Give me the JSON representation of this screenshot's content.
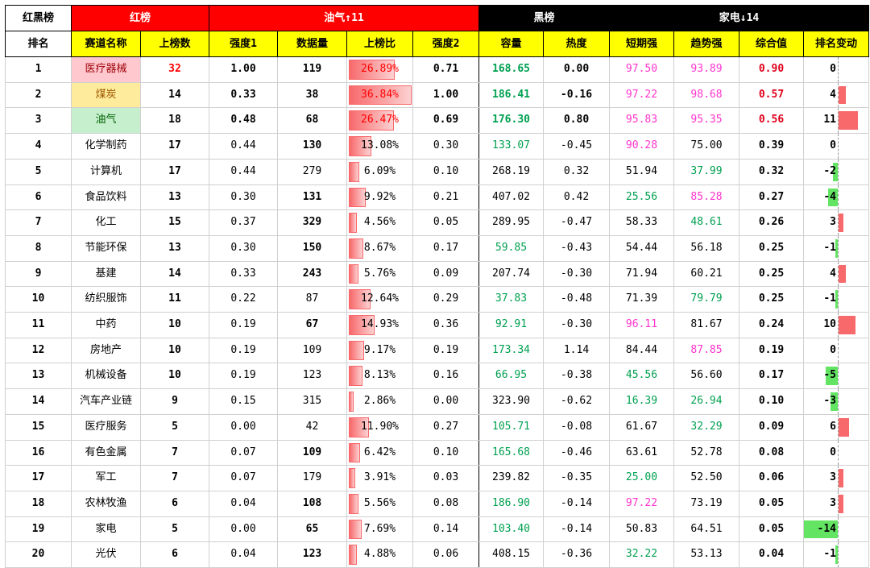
{
  "banner": {
    "title": "红黑榜",
    "red_label": "红榜",
    "top_label": "油气",
    "top_count": "11",
    "black_label": "黑榜",
    "bottom_label": "家电",
    "bottom_count": "14"
  },
  "headers": [
    "排名",
    "赛道名称",
    "上榜数",
    "强度1",
    "数据量",
    "上榜比",
    "强度2",
    "容量",
    "热度",
    "短期强",
    "趋势强",
    "综合值",
    "排名变动"
  ],
  "rows": [
    {
      "rank": "1",
      "name": "医疗器械",
      "count": "32",
      "s1": "1.00",
      "data": "119",
      "ratio": "26.89%",
      "ratio_val": 0.2689,
      "s2": "0.71",
      "cap": "168.65",
      "heat": "0.00",
      "short": "97.50",
      "trend": "93.89",
      "comp": "0.90",
      "chg": "0",
      "chg_val": 0
    },
    {
      "rank": "2",
      "name": "煤炭",
      "count": "14",
      "s1": "0.33",
      "data": "38",
      "ratio": "36.84%",
      "ratio_val": 0.3684,
      "s2": "1.00",
      "cap": "186.41",
      "heat": "-0.16",
      "short": "97.22",
      "trend": "98.68",
      "comp": "0.57",
      "chg": "4",
      "chg_val": 4
    },
    {
      "rank": "3",
      "name": "油气",
      "count": "18",
      "s1": "0.48",
      "data": "68",
      "ratio": "26.47%",
      "ratio_val": 0.2647,
      "s2": "0.69",
      "cap": "176.30",
      "heat": "0.80",
      "short": "95.83",
      "trend": "95.35",
      "comp": "0.56",
      "chg": "11",
      "chg_val": 11
    },
    {
      "rank": "4",
      "name": "化学制药",
      "count": "17",
      "s1": "0.44",
      "data": "130",
      "ratio": "13.08%",
      "ratio_val": 0.1308,
      "s2": "0.30",
      "cap": "133.07",
      "heat": "-0.45",
      "short": "90.28",
      "trend": "75.00",
      "comp": "0.39",
      "chg": "0",
      "chg_val": 0
    },
    {
      "rank": "5",
      "name": "计算机",
      "count": "17",
      "s1": "0.44",
      "data": "279",
      "ratio": "6.09%",
      "ratio_val": 0.0609,
      "s2": "0.10",
      "cap": "268.19",
      "heat": "0.32",
      "short": "51.94",
      "trend": "37.99",
      "comp": "0.32",
      "chg": "-2",
      "chg_val": -2
    },
    {
      "rank": "6",
      "name": "食品饮料",
      "count": "13",
      "s1": "0.30",
      "data": "131",
      "ratio": "9.92%",
      "ratio_val": 0.0992,
      "s2": "0.21",
      "cap": "407.02",
      "heat": "0.42",
      "short": "25.56",
      "trend": "85.28",
      "comp": "0.27",
      "chg": "-4",
      "chg_val": -4
    },
    {
      "rank": "7",
      "name": "化工",
      "count": "15",
      "s1": "0.37",
      "data": "329",
      "ratio": "4.56%",
      "ratio_val": 0.0456,
      "s2": "0.05",
      "cap": "289.95",
      "heat": "-0.47",
      "short": "58.33",
      "trend": "48.61",
      "comp": "0.26",
      "chg": "3",
      "chg_val": 3
    },
    {
      "rank": "8",
      "name": "节能环保",
      "count": "13",
      "s1": "0.30",
      "data": "150",
      "ratio": "8.67%",
      "ratio_val": 0.0867,
      "s2": "0.17",
      "cap": "59.85",
      "heat": "-0.43",
      "short": "54.44",
      "trend": "56.18",
      "comp": "0.25",
      "chg": "-1",
      "chg_val": -1
    },
    {
      "rank": "9",
      "name": "基建",
      "count": "14",
      "s1": "0.33",
      "data": "243",
      "ratio": "5.76%",
      "ratio_val": 0.0576,
      "s2": "0.09",
      "cap": "207.74",
      "heat": "-0.30",
      "short": "71.94",
      "trend": "60.21",
      "comp": "0.25",
      "chg": "4",
      "chg_val": 4
    },
    {
      "rank": "10",
      "name": "纺织服饰",
      "count": "11",
      "s1": "0.22",
      "data": "87",
      "ratio": "12.64%",
      "ratio_val": 0.1264,
      "s2": "0.29",
      "cap": "37.83",
      "heat": "-0.48",
      "short": "71.39",
      "trend": "79.79",
      "comp": "0.25",
      "chg": "-1",
      "chg_val": -1
    },
    {
      "rank": "11",
      "name": "中药",
      "count": "10",
      "s1": "0.19",
      "data": "67",
      "ratio": "14.93%",
      "ratio_val": 0.1493,
      "s2": "0.36",
      "cap": "92.91",
      "heat": "-0.30",
      "short": "96.11",
      "trend": "81.67",
      "comp": "0.24",
      "chg": "10",
      "chg_val": 10
    },
    {
      "rank": "12",
      "name": "房地产",
      "count": "10",
      "s1": "0.19",
      "data": "109",
      "ratio": "9.17%",
      "ratio_val": 0.0917,
      "s2": "0.19",
      "cap": "173.34",
      "heat": "1.14",
      "short": "84.44",
      "trend": "87.85",
      "comp": "0.19",
      "chg": "0",
      "chg_val": 0
    },
    {
      "rank": "13",
      "name": "机械设备",
      "count": "10",
      "s1": "0.19",
      "data": "123",
      "ratio": "8.13%",
      "ratio_val": 0.0813,
      "s2": "0.16",
      "cap": "66.95",
      "heat": "-0.38",
      "short": "45.56",
      "trend": "56.60",
      "comp": "0.17",
      "chg": "-5",
      "chg_val": -5
    },
    {
      "rank": "14",
      "name": "汽车产业链",
      "count": "9",
      "s1": "0.15",
      "data": "315",
      "ratio": "2.86%",
      "ratio_val": 0.0286,
      "s2": "0.00",
      "cap": "323.90",
      "heat": "-0.62",
      "short": "16.39",
      "trend": "26.94",
      "comp": "0.10",
      "chg": "-3",
      "chg_val": -3
    },
    {
      "rank": "15",
      "name": "医疗服务",
      "count": "5",
      "s1": "0.00",
      "data": "42",
      "ratio": "11.90%",
      "ratio_val": 0.119,
      "s2": "0.27",
      "cap": "105.71",
      "heat": "-0.08",
      "short": "61.67",
      "trend": "32.29",
      "comp": "0.09",
      "chg": "6",
      "chg_val": 6
    },
    {
      "rank": "16",
      "name": "有色金属",
      "count": "7",
      "s1": "0.07",
      "data": "109",
      "ratio": "6.42%",
      "ratio_val": 0.0642,
      "s2": "0.10",
      "cap": "165.68",
      "heat": "-0.46",
      "short": "63.61",
      "trend": "52.78",
      "comp": "0.08",
      "chg": "0",
      "chg_val": 0
    },
    {
      "rank": "17",
      "name": "军工",
      "count": "7",
      "s1": "0.07",
      "data": "179",
      "ratio": "3.91%",
      "ratio_val": 0.0391,
      "s2": "0.03",
      "cap": "239.82",
      "heat": "-0.35",
      "short": "25.00",
      "trend": "52.50",
      "comp": "0.06",
      "chg": "3",
      "chg_val": 3
    },
    {
      "rank": "18",
      "name": "农林牧渔",
      "count": "6",
      "s1": "0.04",
      "data": "108",
      "ratio": "5.56%",
      "ratio_val": 0.0556,
      "s2": "0.08",
      "cap": "186.90",
      "heat": "-0.14",
      "short": "97.22",
      "trend": "73.19",
      "comp": "0.05",
      "chg": "3",
      "chg_val": 3
    },
    {
      "rank": "19",
      "name": "家电",
      "count": "5",
      "s1": "0.00",
      "data": "65",
      "ratio": "7.69%",
      "ratio_val": 0.0769,
      "s2": "0.14",
      "cap": "103.40",
      "heat": "-0.14",
      "short": "50.83",
      "trend": "64.51",
      "comp": "0.05",
      "chg": "-14",
      "chg_val": -14
    },
    {
      "rank": "20",
      "name": "光伏",
      "count": "6",
      "s1": "0.04",
      "data": "123",
      "ratio": "4.88%",
      "ratio_val": 0.0488,
      "s2": "0.06",
      "cap": "408.15",
      "heat": "-0.36",
      "short": "32.22",
      "trend": "53.13",
      "comp": "0.04",
      "chg": "-1",
      "chg_val": -1
    }
  ],
  "colors": {
    "red_banner": "#ff0000",
    "black_banner": "#000000",
    "header_bg": "#ffff00",
    "bar_pos": "#f8696b",
    "bar_neg": "#63e563"
  }
}
